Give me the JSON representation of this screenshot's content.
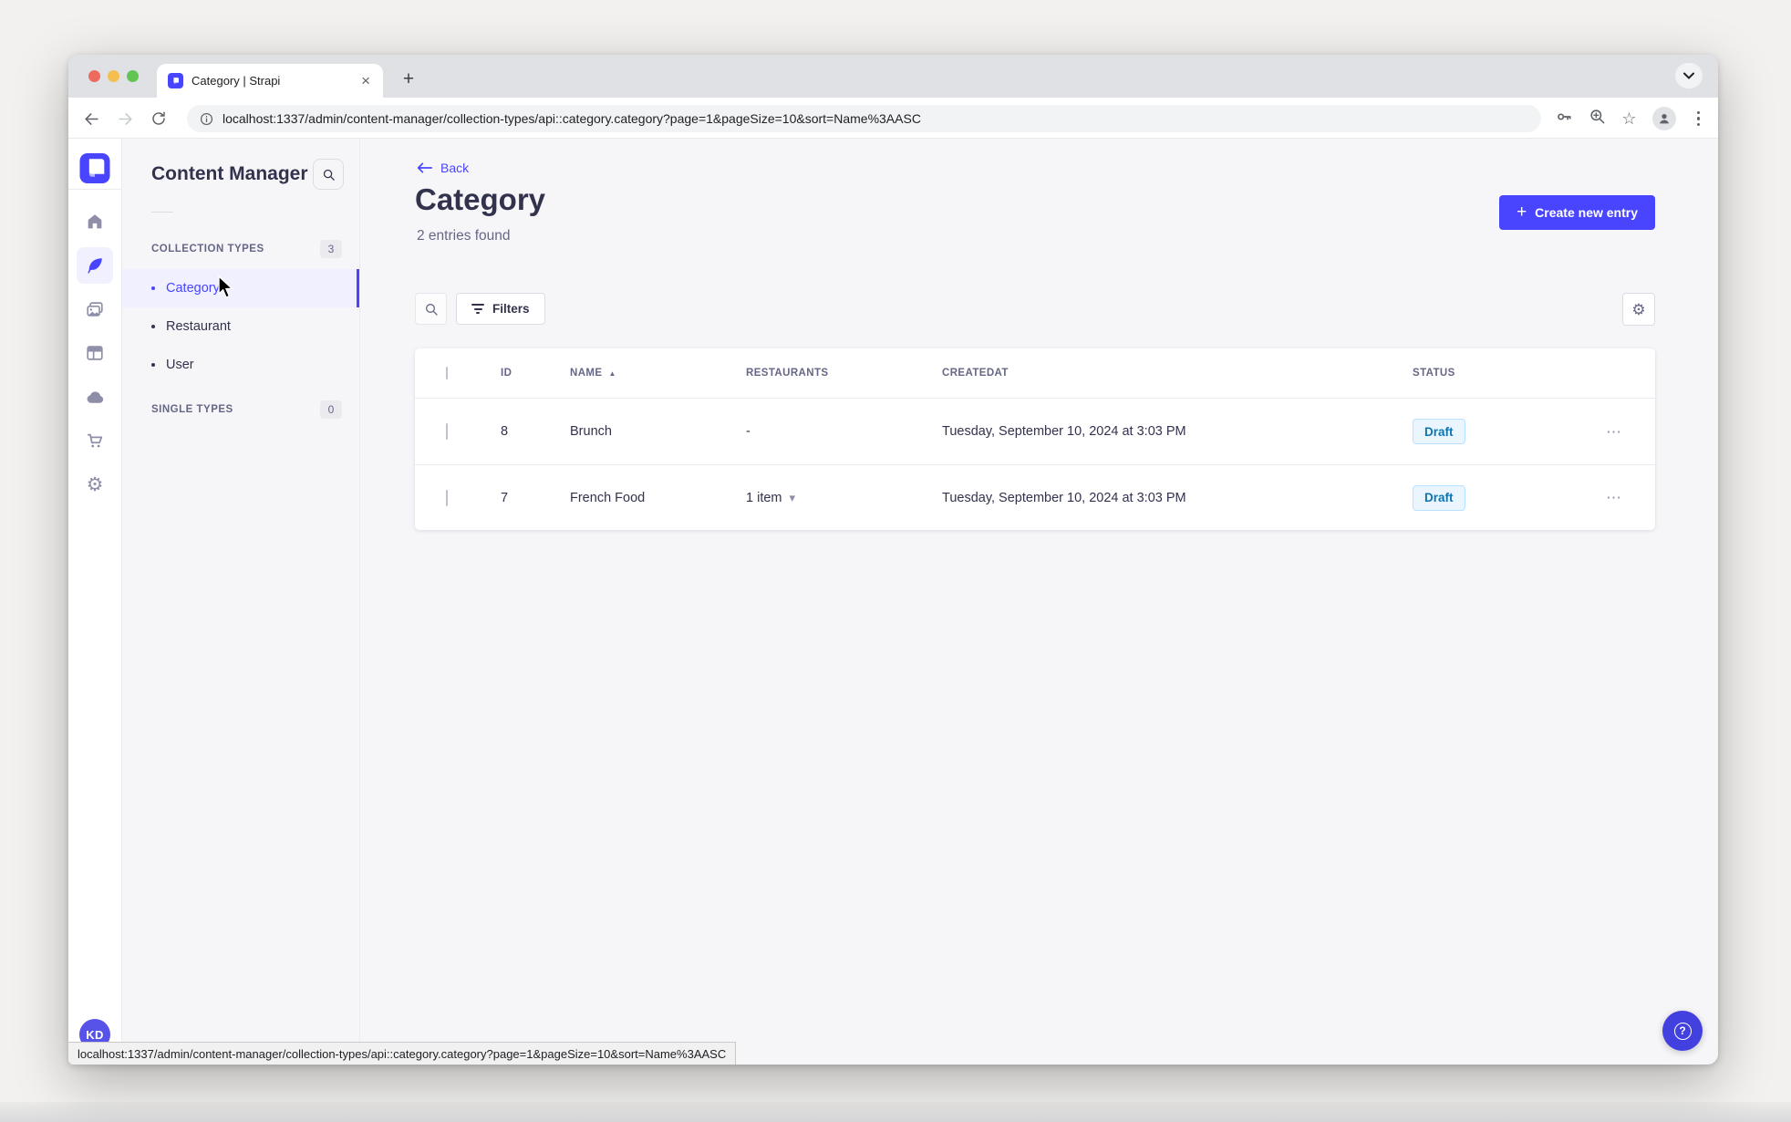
{
  "browser": {
    "tab_title": "Category | Strapi",
    "url": "localhost:1337/admin/content-manager/collection-types/api::category.category?page=1&pageSize=10&sort=Name%3AASC",
    "status_url": "localhost:1337/admin/content-manager/collection-types/api::category.category?page=1&pageSize=10&sort=Name%3AASC"
  },
  "nav_rail": {
    "avatar_initials": "KD"
  },
  "panel": {
    "title": "Content Manager",
    "collection_types_label": "COLLECTION TYPES",
    "collection_types_count": "3",
    "items": [
      {
        "label": "Category"
      },
      {
        "label": "Restaurant"
      },
      {
        "label": "User"
      }
    ],
    "single_types_label": "SINGLE TYPES",
    "single_types_count": "0"
  },
  "header": {
    "back_label": "Back",
    "title": "Category",
    "subtitle": "2 entries found",
    "create_button_label": "Create new entry"
  },
  "filters": {
    "filters_label": "Filters"
  },
  "table": {
    "columns": [
      "ID",
      "NAME",
      "RESTAURANTS",
      "CREATEDAT",
      "STATUS"
    ],
    "rows": [
      {
        "id": "8",
        "name": "Brunch",
        "restaurants": "-",
        "createdat": "Tuesday, September 10, 2024 at 3:03 PM",
        "status": "Draft"
      },
      {
        "id": "7",
        "name": "French Food",
        "restaurants": "1 item",
        "createdat": "Tuesday, September 10, 2024 at 3:03 PM",
        "status": "Draft"
      }
    ]
  },
  "icons": {
    "plus": "+",
    "gear": "⚙",
    "dots_h": "⋯",
    "sort_asc": "▲",
    "chevron_down_small": "▾",
    "close": "×",
    "star": "☆",
    "question": "?"
  },
  "colors": {
    "accent": "#4945ff",
    "selected_bg": "#f0f0ff",
    "draft_bg": "#eaf5ff",
    "draft_border": "#b8e1ff",
    "draft_text": "#0c75af",
    "traffic_red": "#ed6a5e",
    "traffic_yellow": "#f5bf4f",
    "traffic_green": "#61c554"
  }
}
